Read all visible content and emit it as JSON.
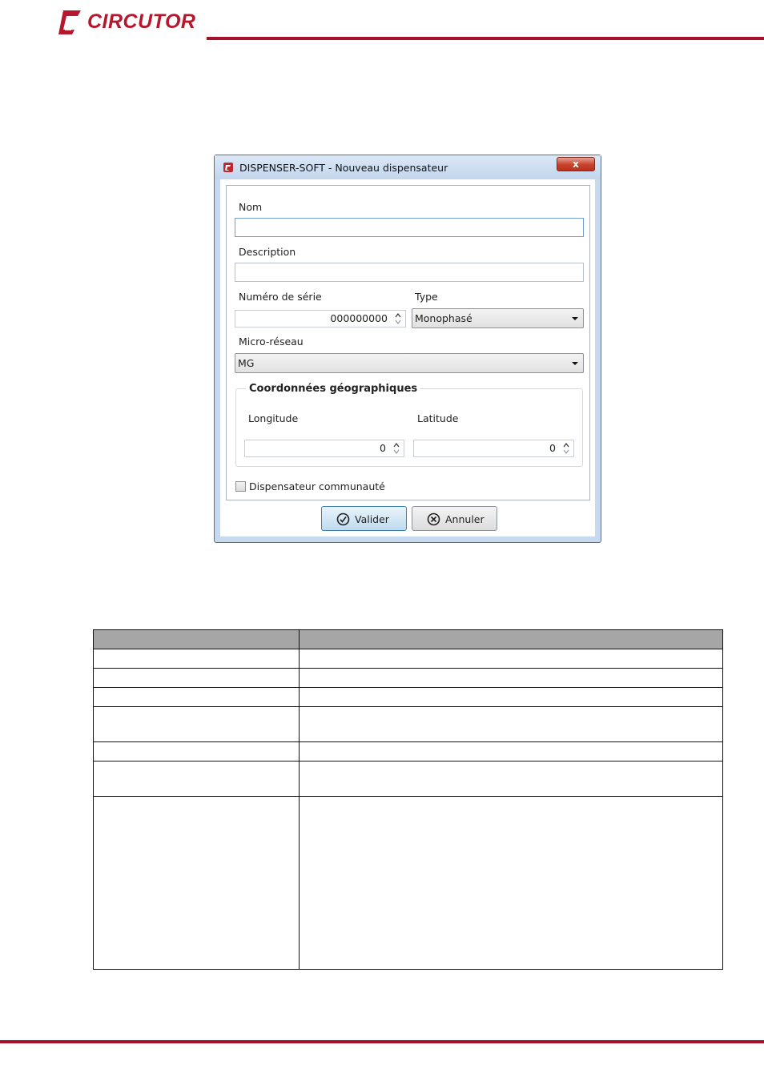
{
  "header": {
    "brand": "CIRCUTOR",
    "brand_color": "#b5172f",
    "rule_color": "#a5122a"
  },
  "dialog": {
    "title": "DISPENSER-SOFT - Nouveau dispensateur",
    "close_label": "x",
    "fields": {
      "nom_label": "Nom",
      "nom_value": "",
      "description_label": "Description",
      "description_value": "",
      "serial_label": "Numéro de série",
      "serial_value": "000000000",
      "type_label": "Type",
      "type_value": "Monophasé",
      "micro_label": "Micro-réseau",
      "micro_value": "MG"
    },
    "geo": {
      "title": "Coordonnées géographiques",
      "longitude_label": "Longitude",
      "longitude_value": "0",
      "latitude_label": "Latitude",
      "latitude_value": "0"
    },
    "checkbox_label": "Dispensateur communauté",
    "checkbox_checked": false,
    "buttons": {
      "ok_label": "Valider",
      "cancel_label": "Annuler"
    }
  },
  "table": {
    "header_color": "#a6a6a6",
    "rows": 7
  }
}
